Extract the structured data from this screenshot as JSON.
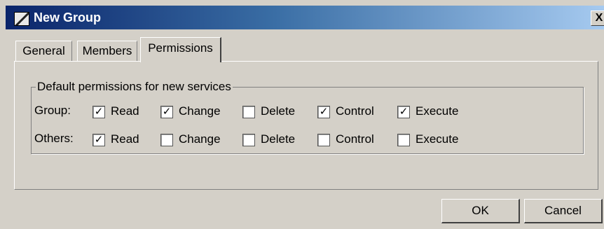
{
  "window": {
    "title": "New Group",
    "close_label": "X"
  },
  "tabs": [
    {
      "label": "General"
    },
    {
      "label": "Members"
    },
    {
      "label": "Permissions",
      "active": true
    }
  ],
  "permissions": {
    "legend": "Default permissions for new services",
    "rows": [
      {
        "label": "Group:",
        "items": [
          {
            "label": "Read",
            "checked": true
          },
          {
            "label": "Change",
            "checked": true
          },
          {
            "label": "Delete",
            "checked": false
          },
          {
            "label": "Control",
            "checked": true
          },
          {
            "label": "Execute",
            "checked": true
          }
        ]
      },
      {
        "label": "Others:",
        "items": [
          {
            "label": "Read",
            "checked": true
          },
          {
            "label": "Change",
            "checked": false
          },
          {
            "label": "Delete",
            "checked": false
          },
          {
            "label": "Control",
            "checked": false
          },
          {
            "label": "Execute",
            "checked": false
          }
        ]
      }
    ]
  },
  "buttons": {
    "ok": "OK",
    "cancel": "Cancel"
  },
  "check_mark": "✓"
}
